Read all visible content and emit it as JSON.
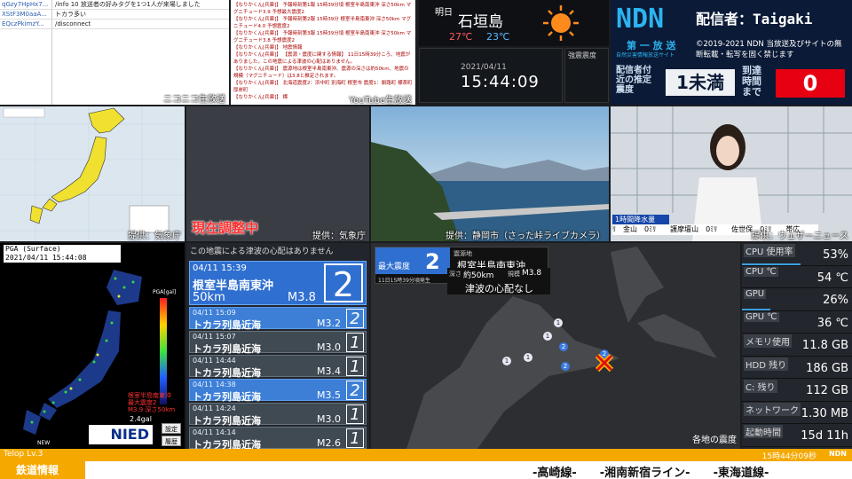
{
  "chat": {
    "rows": [
      {
        "user": "qGzy7HpHx7...",
        "msg": "/info 10 放送者の好みタグを1つ1人が来場しました"
      },
      {
        "user": "XStF3M0aaA...",
        "msg": "トカラ多い"
      },
      {
        "user": "EQczPkimzY...",
        "msg": "/disconnect"
      }
    ],
    "source_label": "ニコニコ生放送"
  },
  "ytchat": {
    "lines": [
      "【なりかくん[兵庫]】 予報時刻第1報 15時39分頃 根室半島南東沖 深さ50km マグニチュード3.9 予想最大震度2",
      "【なりかくん[兵庫]】 予報時刻第2報 15時39分 根室半島南東沖 深さ50km マグニチュード4.0 予想震度2",
      "【なりかくん[兵庫]】 予報時刻第3報 15時39分頃 根室半島南東沖 深さ50km マグニチュード3.8 予想震度2",
      "【なりかくん[兵庫]】 地震情報",
      "【なりかくん[兵庫]】 【震源・震度に関する情報】 11日15時39分ころ、地震がありました。この地震による津波の心配はありません。",
      "【なりかくん[兵庫]】 震源地は根室半島南東沖、震源の深さは約50km、地震の規模（マグニチュード）は3.8と推定されます。",
      "【なりかくん[兵庫]】 北海道震度2：浜中町 別海町 根室市 震度1：釧路町 標茶町 厚岸町",
      "【なりかくん[兵庫]】 標"
    ],
    "source_label": "YouTube生放送"
  },
  "weather": {
    "city": "石垣島",
    "label": "明日",
    "high": "27℃",
    "low": "23℃",
    "icon": "sun-icon"
  },
  "clock": {
    "date": "2021/04/11",
    "time": "15:44:09"
  },
  "intensity_label": "強震震度",
  "ndn": {
    "logo": "NDN",
    "streamer": "配信者：Taigaki",
    "tagline1": "第 一 放 送",
    "tagline2": "自然災害情報放送サイト",
    "copyright": "©2019-2021 NDN 当放送及びサイトの無断転載・転写を固く禁じます",
    "est_label": "配信者付近の推定震度",
    "est_value": "1未満",
    "arrival_label": "到達時間まで",
    "arrival_value": "0"
  },
  "jpmap": {
    "source": "提供：気象庁"
  },
  "adjust": {
    "text": "現在調整中",
    "source": "提供：気象庁"
  },
  "cam": {
    "source": "提供：静岡市（さった峠ライブカメラ）"
  },
  "studio": {
    "source": "提供：ウェザーニュース",
    "rain_title": "1時間降水量",
    "rain": "ﾘ　金山　0ﾐﾘ　　護摩壇山　0ﾐﾘ　　佐世保　0ﾐﾘ　　帯広"
  },
  "pga": {
    "title": "PGA (Surface)",
    "time": "2021/04/11 15:44:08",
    "scale_max": "PGA[gal]",
    "eq_info": "根室半島南東沖\n最大震度2\nM3.9 深さ50km",
    "gal": "2.4gal",
    "new": "NEW",
    "logo": "NIED",
    "btn1": "設定",
    "btn2": "履歴"
  },
  "eqlist": {
    "header": "この地震による津波の心配はありません",
    "main": {
      "time": "04/11 15:39",
      "name": "根室半島南東沖",
      "depth": "50km",
      "mag": "M3.8",
      "shindo": "2"
    },
    "rows": [
      {
        "time": "04/11 15:09",
        "name": "トカラ列島近海",
        "mag": "M3.2",
        "shindo": "2",
        "blue": true
      },
      {
        "time": "04/11 15:07",
        "name": "トカラ列島近海",
        "mag": "M3.0",
        "shindo": "1",
        "blue": false
      },
      {
        "time": "04/11 14:44",
        "name": "トカラ列島近海",
        "mag": "M3.4",
        "shindo": "1",
        "blue": false
      },
      {
        "time": "04/11 14:38",
        "name": "トカラ列島近海",
        "mag": "M3.5",
        "shindo": "2",
        "blue": true
      },
      {
        "time": "04/11 14:24",
        "name": "トカラ列島近海",
        "mag": "M3.0",
        "shindo": "1",
        "blue": false
      },
      {
        "time": "04/11 14:14",
        "name": "トカラ列島近海",
        "mag": "M2.6",
        "shindo": "1",
        "blue": false
      }
    ]
  },
  "hokmap": {
    "max_label": "最大震度",
    "max_value": "2",
    "epi_label": "震源地",
    "epi": "根室半島南東沖",
    "occurred": "11日15時39分頃発生",
    "depth_label": "深さ",
    "depth": "約50km",
    "mag_label": "規模",
    "mag": "M3.8",
    "tsunami": "津波の心配なし",
    "footer": "各地の震度"
  },
  "stats": [
    {
      "k": "CPU 使用率",
      "v": "53%",
      "pct": 0.53
    },
    {
      "k": "CPU ℃",
      "v": "54 ℃",
      "pct": 0
    },
    {
      "k": "GPU",
      "v": "26%",
      "pct": 0.26
    },
    {
      "k": "GPU ℃",
      "v": "36 ℃",
      "pct": 0
    },
    {
      "k": "メモリ使用",
      "v": "11.8 GB",
      "pct": 0
    },
    {
      "k": "HDD 残り",
      "v": "186 GB",
      "pct": 0
    },
    {
      "k": "C: 残り",
      "v": "112 GB",
      "pct": 0
    },
    {
      "k": "ネットワーク",
      "v": "1.30 MB",
      "pct": 0
    },
    {
      "k": "起動時間",
      "v": "15d 11h",
      "pct": 0
    }
  ],
  "bar1": {
    "left": "Telop Lv.3",
    "right": "15時44分09秒",
    "logo": "NDN"
  },
  "bar2": {
    "label": "鉄道情報",
    "ticker": "-高崎線-　　-湘南新宿ライン-　　-東海道線-"
  }
}
